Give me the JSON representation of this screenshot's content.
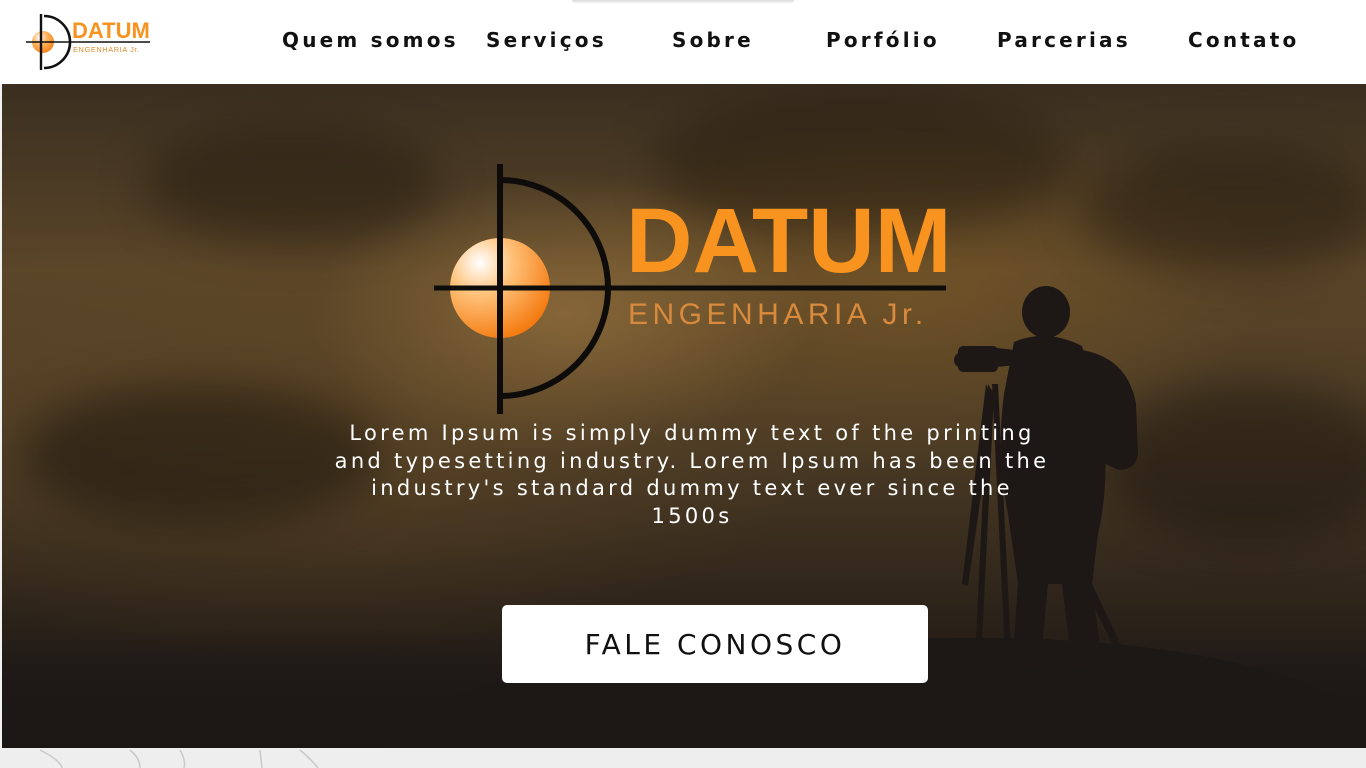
{
  "brand": {
    "name": "DATUM",
    "subtitle": "ENGENHARIA Jr.",
    "accent": "#f7931e",
    "accent_light": "#ffd7a8",
    "subtitle_color": "#d98a3c"
  },
  "nav": {
    "items": [
      {
        "label": "Quem somos"
      },
      {
        "label": "Serviços"
      },
      {
        "label": "Sobre"
      },
      {
        "label": "Porfólio"
      },
      {
        "label": "Parcerias"
      },
      {
        "label": "Contato"
      }
    ]
  },
  "hero": {
    "description": "Lorem Ipsum is simply dummy text of the printing and typesetting industry. Lorem Ipsum has been the industry's standard dummy text ever since the 1500s",
    "cta_label": "FALE CONOSCO"
  },
  "icons": {
    "logo": "datum-crosshair-logo",
    "photographer": "photographer-silhouette"
  }
}
